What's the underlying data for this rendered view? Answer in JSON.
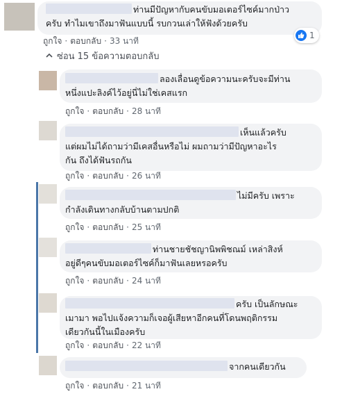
{
  "top_comment": {
    "lines": [
      "ท่านมีปัญหากับคนขับมอเตอร์ไซค์มากป่าว",
      "ครับ ทำไมเขาถึงมาฟันแบบนี้ รบกวนเล่าให้ฟังด้วยครับ"
    ],
    "like_label": "ถูกใจ",
    "reply_label": "ตอบกลับ",
    "time": "33 นาที",
    "reaction_count": "1"
  },
  "hide_replies_label": "ซ่อน 15 ข้อความตอบกลับ",
  "replies": [
    {
      "lines": [
        "ลองเลื่อนดูข้อความนะครับจะมีท่าน",
        "หนึ่งแปะลิงค์ไว้อยู่นี่ไม่ใช่เคสแรก"
      ],
      "like_label": "ถูกใจ",
      "reply_label": "ตอบกลับ",
      "time": "28 นาที"
    },
    {
      "lines": [
        "เห็นแล้วครับ",
        "แต่ผมไม่ได้ถามว่ามีเคสอื่นหรือไม่ ผมถามว่ามีปัญหาอะไร",
        "กัน ถึงได้ฟันรถกัน"
      ],
      "like_label": "ถูกใจ",
      "reply_label": "ตอบกลับ",
      "time": "26 นาที"
    },
    {
      "lines": [
        "ไม่มีครับ เพราะ",
        "กำลังเดินทางกลับบ้านตามปกติ"
      ],
      "like_label": "ถูกใจ",
      "reply_label": "ตอบกลับ",
      "time": "25 นาที"
    },
    {
      "lines": [
        "ท่านชายชัชญานิพพิชณม์ เหล่าสิงห์",
        "อยู่ดีๆคนขับมอเตอร์ไซค์ก็มาฟันเลยหรอครับ"
      ],
      "like_label": "ถูกใจ",
      "reply_label": "ตอบกลับ",
      "time": "24 นาที"
    },
    {
      "lines": [
        "ครับ เป็นลักษณะ",
        "เมามา พอไปแจ้งความก็เจอผู้เสียหาอีกคนที่โดนพฤติกรรม",
        "เดียวกันนี้ในเมืองครับ"
      ],
      "like_label": "ถูกใจ",
      "reply_label": "ตอบกลับ",
      "time": "22 นาที"
    },
    {
      "lines": [
        "จากคนเดียวกัน"
      ],
      "like_label": "ถูกใจ",
      "reply_label": "ตอบกลับ",
      "time": "21 นาที"
    }
  ]
}
